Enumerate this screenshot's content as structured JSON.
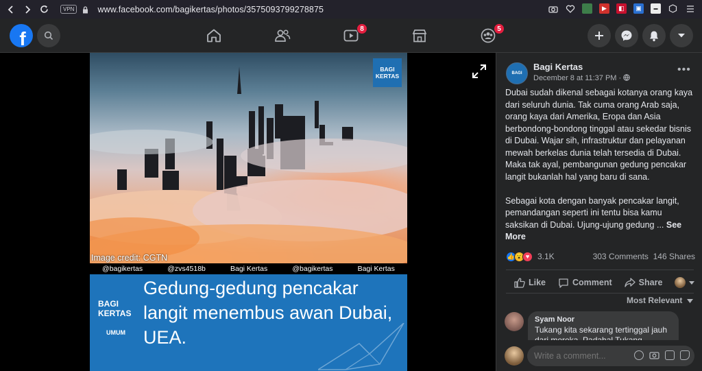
{
  "browser": {
    "vpn_label": "VPN",
    "url": "www.facebook.com/bagikertas/photos/3575093799278875"
  },
  "header": {
    "logo_letter": "f",
    "watch_badge": "8",
    "groups_badge": "5"
  },
  "photo": {
    "image_credit": "Image credit: CGTN",
    "handles": [
      "@bagikertas",
      "@zvs4518b",
      "Bagi Kertas",
      "@bagikertas",
      "Bagi Kertas"
    ],
    "brand_logo_line1": "BAGI",
    "brand_logo_line2": "KERTAS",
    "category": "UMUM",
    "caption": "Gedung-gedung pencakar langit menembus awan Dubai, UEA."
  },
  "post": {
    "page_name": "Bagi Kertas",
    "timestamp": "December 8 at 11:37 PM ·",
    "paragraph1": "Dubai sudah dikenal sebagai kotanya orang kaya dari seluruh dunia. Tak cuma orang Arab saja, orang kaya dari Amerika, Eropa dan Asia berbondong-bondong tinggal atau sekedar bisnis di Dubai. Wajar sih, infrastruktur dan pelayanan mewah berkelas dunia telah tersedia di Dubai. Maka tak ayal, pembangunan gedung pencakar langit bukanlah hal yang baru di sana.",
    "paragraph2": "Sebagai kota dengan banyak pencakar langit, pemandangan seperti ini tentu bisa kamu saksikan di Dubai. Ujung-ujung gedung ...",
    "see_more": "See More",
    "reaction_count": "3.1K",
    "comments_count": "303 Comments",
    "shares_count": "146 Shares",
    "like_label": "Like",
    "comment_label": "Comment",
    "share_label": "Share",
    "sort_label": "Most Relevant",
    "first_comment": {
      "author": "Syam Noor",
      "text": "Tukang kita sekarang tertinggal jauh dari mereka. Padahal Tukang"
    },
    "write_placeholder": "Write a comment..."
  },
  "colors": {
    "fb_blue": "#1877f2",
    "panel_bg": "#242526",
    "badge_red": "#e41e3f",
    "brand_blue": "#1e74bb"
  }
}
